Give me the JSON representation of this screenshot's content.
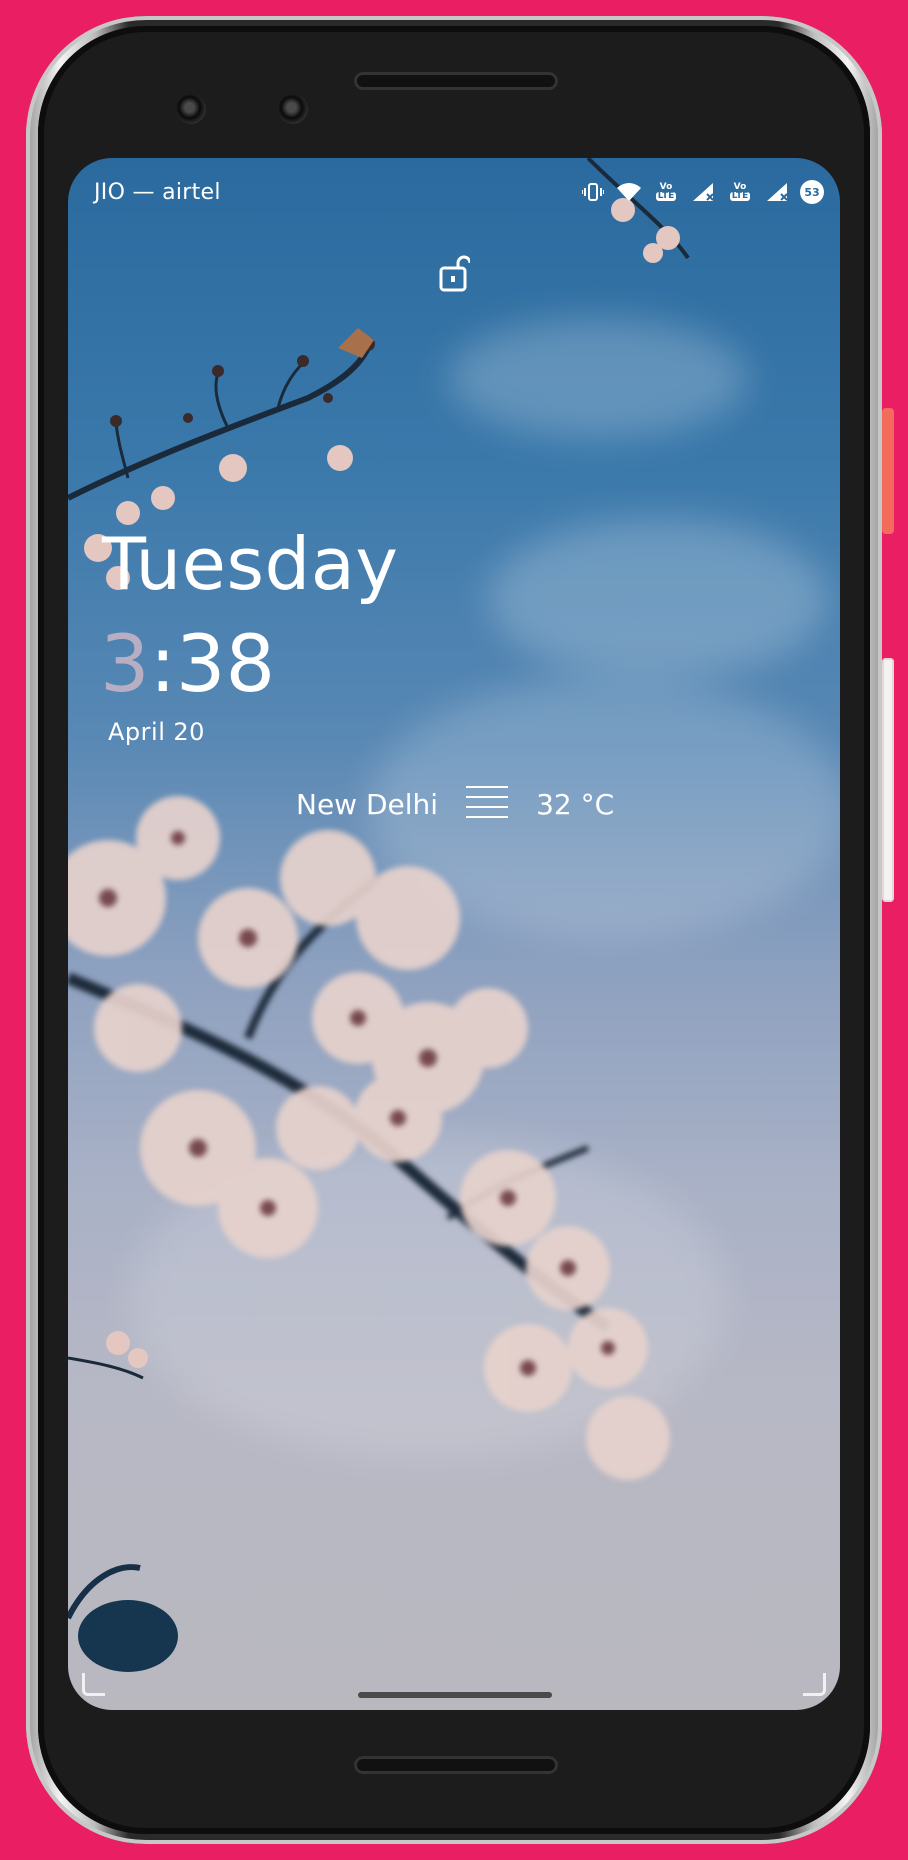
{
  "status_bar": {
    "carrier": "JIO — airtel",
    "battery": "53",
    "icons": [
      "vibrate-icon",
      "wifi-icon",
      "volte-lte-icon",
      "signal-icon",
      "volte-lte-icon",
      "signal-icon",
      "battery-icon"
    ],
    "lte_label": "LTE",
    "volte_label": "Vo"
  },
  "lock_screen": {
    "day": "Tuesday",
    "time_hour": "3",
    "time_rest": ":38",
    "date_month": "April",
    "date_day": "20",
    "weather": {
      "city": "New Delhi",
      "temperature": "32 °C",
      "icon": "fog-icon"
    }
  },
  "colors": {
    "background": "#e91e63",
    "hour_digit": "#b8aec4",
    "text": "#ffffff"
  }
}
